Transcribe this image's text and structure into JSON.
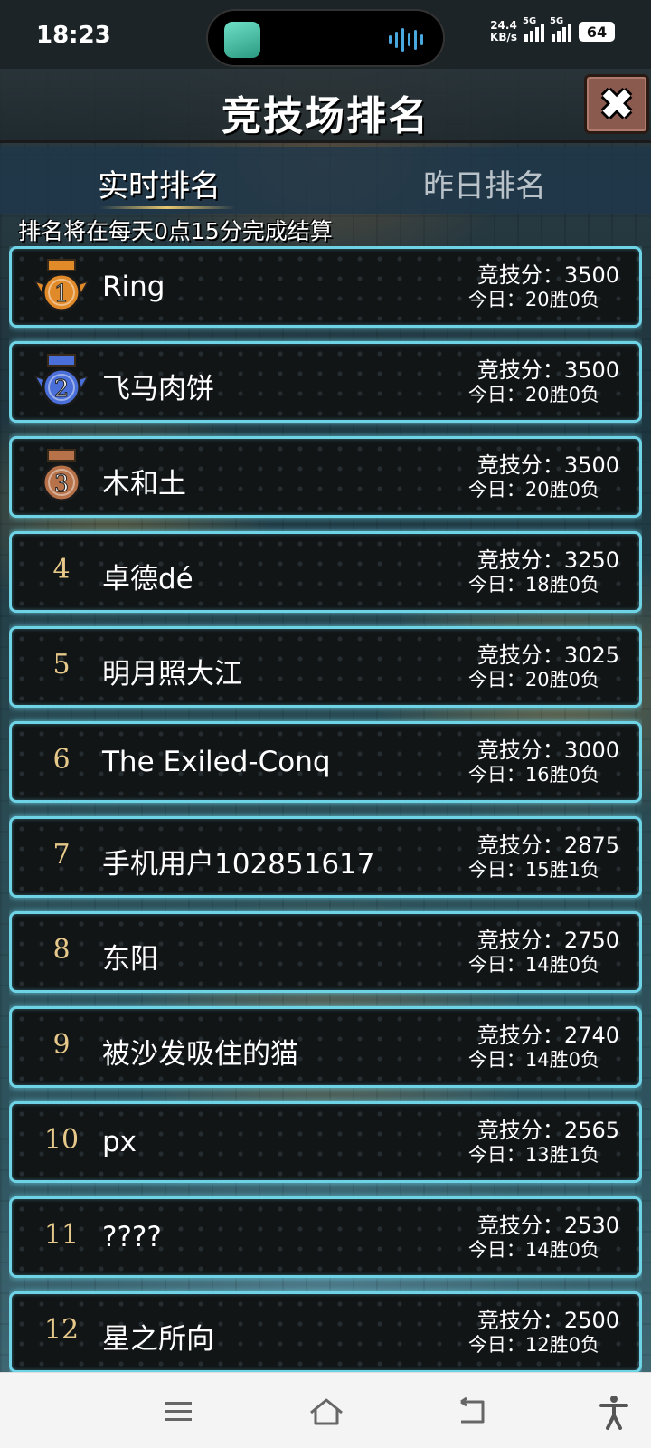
{
  "status_bar": {
    "time": "18:23",
    "net_speed_value": "24.4",
    "net_speed_unit": "KB/s",
    "signal1_label": "5G",
    "signal2_label": "5G",
    "battery": "64"
  },
  "header": {
    "title": "竞技场排名",
    "close_icon": "close-icon"
  },
  "tabs": [
    {
      "label": "实时排名",
      "active": true
    },
    {
      "label": "昨日排名",
      "active": false
    }
  ],
  "notice": "排名将在每天0点15分完成结算",
  "rankings": [
    {
      "rank": "1",
      "name": "Ring",
      "score": "竞技分：3500",
      "record": "今日：20胜0负",
      "medal": "gold"
    },
    {
      "rank": "2",
      "name": "飞马肉饼",
      "score": "竞技分：3500",
      "record": "今日：20胜0负",
      "medal": "silver"
    },
    {
      "rank": "3",
      "name": "木和土",
      "score": "竞技分：3500",
      "record": "今日：20胜0负",
      "medal": "bronze"
    },
    {
      "rank": "4",
      "name": "卓德dé",
      "score": "竞技分：3250",
      "record": "今日：18胜0负"
    },
    {
      "rank": "5",
      "name": "明月照大江",
      "score": "竞技分：3025",
      "record": "今日：20胜0负"
    },
    {
      "rank": "6",
      "name": "The Exiled-Conq",
      "score": "竞技分：3000",
      "record": "今日：16胜0负"
    },
    {
      "rank": "7",
      "name": "手机用户102851617",
      "score": "竞技分：2875",
      "record": "今日：15胜1负"
    },
    {
      "rank": "8",
      "name": "东阳",
      "score": "竞技分：2750",
      "record": "今日：14胜0负"
    },
    {
      "rank": "9",
      "name": "被沙发吸住的猫",
      "score": "竞技分：2740",
      "record": "今日：14胜0负"
    },
    {
      "rank": "10",
      "name": "px",
      "score": "竞技分：2565",
      "record": "今日：13胜1负"
    },
    {
      "rank": "11",
      "name": "????",
      "score": "竞技分：2530",
      "record": "今日：14胜0负"
    },
    {
      "rank": "12",
      "name": "星之所向",
      "score": "竞技分：2500",
      "record": "今日：12胜0负"
    }
  ],
  "nav": {
    "icons": [
      "menu-icon",
      "home-icon",
      "back-icon",
      "accessibility-icon"
    ]
  },
  "colors": {
    "row_border": "#6fd3e6",
    "rank_number": "#e6c88a",
    "gold_medal": "#e08a2a",
    "silver_medal": "#4a6fd8",
    "bronze_medal": "#b8724a"
  }
}
